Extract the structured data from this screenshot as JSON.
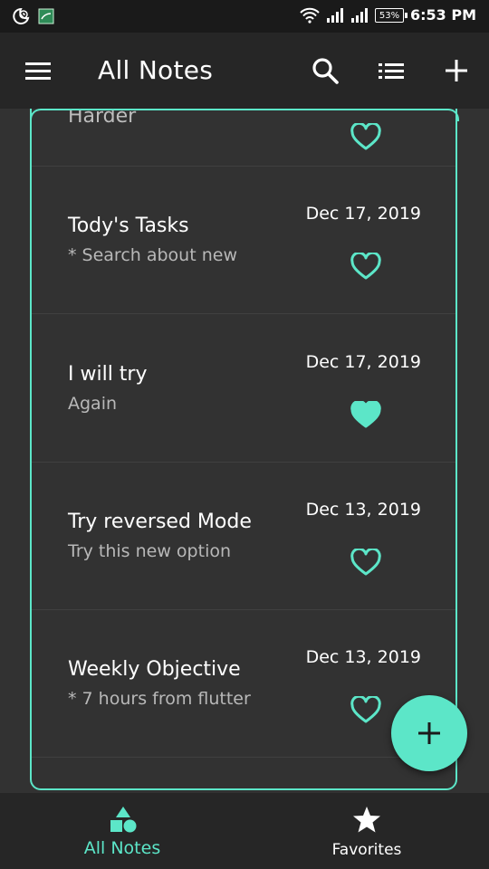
{
  "status_bar": {
    "battery": "53%",
    "time": "6:53 PM"
  },
  "app_bar": {
    "title": "All Notes",
    "icons": [
      "menu-icon",
      "search-icon",
      "list-view-icon",
      "add-icon"
    ]
  },
  "notes": [
    {
      "title": "Harder",
      "subtitle": "",
      "date": "",
      "favorite": false,
      "partial": true
    },
    {
      "title": "Tody's Tasks",
      "subtitle": "* Search about new",
      "date": "Dec 17, 2019",
      "favorite": false
    },
    {
      "title": "I will try",
      "subtitle": "Again",
      "date": "Dec 17, 2019",
      "favorite": true
    },
    {
      "title": "Try reversed Mode",
      "subtitle": "Try this new option",
      "date": "Dec 13, 2019",
      "favorite": false
    },
    {
      "title": "Weekly Objective",
      "subtitle": "* 7 hours from flutter",
      "date": "Dec 13, 2019",
      "favorite": false
    }
  ],
  "fab": {
    "icon": "add-icon"
  },
  "bottom_nav": {
    "items": [
      {
        "label": "All Notes",
        "icon": "shapes-icon",
        "active": true
      },
      {
        "label": "Favorites",
        "icon": "star-icon",
        "active": false
      }
    ]
  },
  "colors": {
    "accent": "#5ce6c8",
    "background": "#323232",
    "bar": "#262626"
  }
}
